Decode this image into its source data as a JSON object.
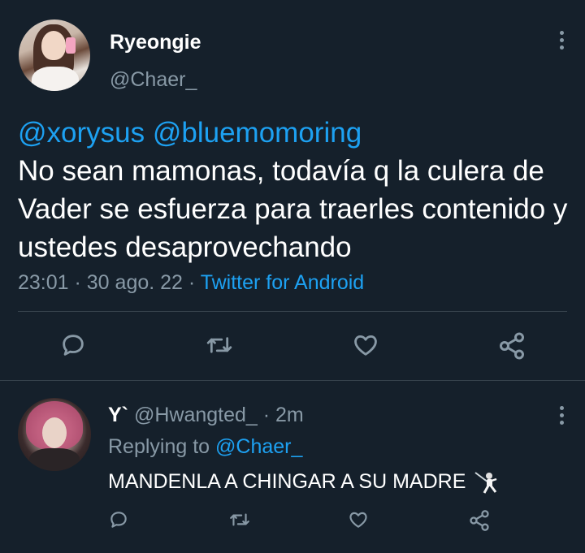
{
  "main_tweet": {
    "display_name": "Ryeongie",
    "handle": "@Chaer_",
    "mentions": [
      "@xorysus",
      "@bluemomoring"
    ],
    "text": "No sean mamonas, todavía q la culera de Vader se esfuerza para traerles contenido y ustedes desaprovechando",
    "time": "23:01",
    "separator": " · ",
    "date": "30 ago. 22",
    "source": "Twitter for Android",
    "actions": [
      "reply-icon",
      "retweet-icon",
      "like-icon",
      "share-icon"
    ]
  },
  "reply_tweet": {
    "display_name": "Y`",
    "handle": "@Hwangted_",
    "separator": " · ",
    "time": "2m",
    "replying_prefix": "Replying to ",
    "replying_to": "@Chaer_",
    "text": "MANDENLA A CHINGAR A SU MADRE",
    "emoji": "fencer-icon",
    "actions": [
      "reply-icon",
      "retweet-icon",
      "like-icon",
      "share-icon"
    ]
  },
  "colors": {
    "background": "#15202b",
    "text": "#ffffff",
    "muted": "#8899a6",
    "accent": "#1da1f2",
    "divider": "#38444d"
  }
}
